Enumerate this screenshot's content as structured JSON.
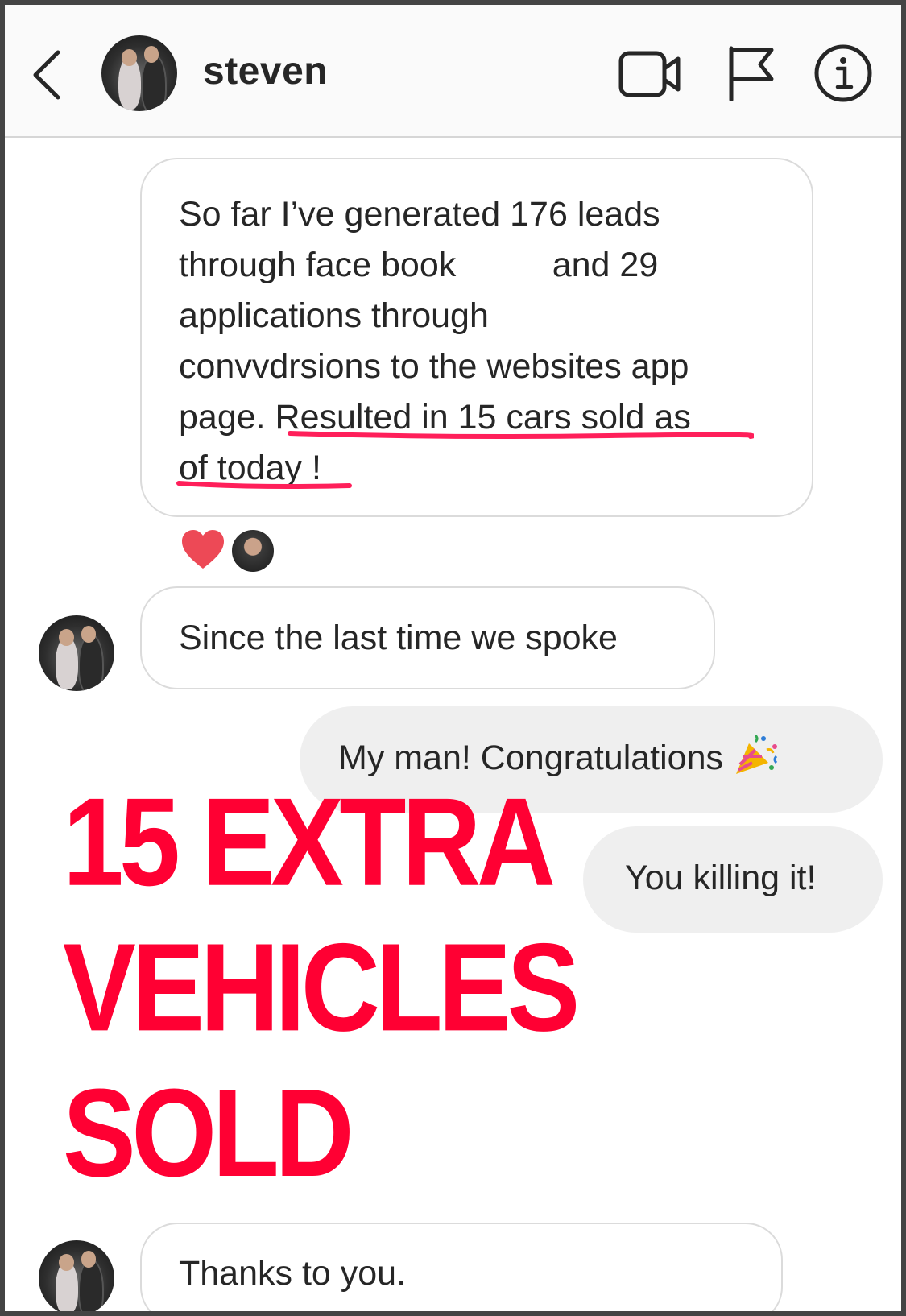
{
  "header": {
    "contact_name": "steven",
    "icons": [
      "back-chevron-icon",
      "video-camera-icon",
      "flag-icon",
      "info-icon"
    ]
  },
  "messages": {
    "m1": "So far I’ve generated 176 leads\nthrough face book          and 29\napplications through\nconvvdrsions to the websites app\npage. Resulted in 15 cars sold as\nof today !",
    "m2": "Since the last time we spoke",
    "m3": "My man! Congratulations",
    "m4": "You killing it!",
    "m5": "Thanks to you."
  },
  "reactions": {
    "icons": [
      "heart-icon"
    ]
  },
  "overlay": {
    "line1": "15 EXTRA",
    "line2": "VEHICLES",
    "line3": "SOLD"
  },
  "colors": {
    "overlay_red": "#ff0033",
    "underline_pink": "#ff1f5a",
    "heart_red": "#ed4956",
    "outgoing_bubble": "#efefef",
    "header_bg": "#fafafa"
  }
}
